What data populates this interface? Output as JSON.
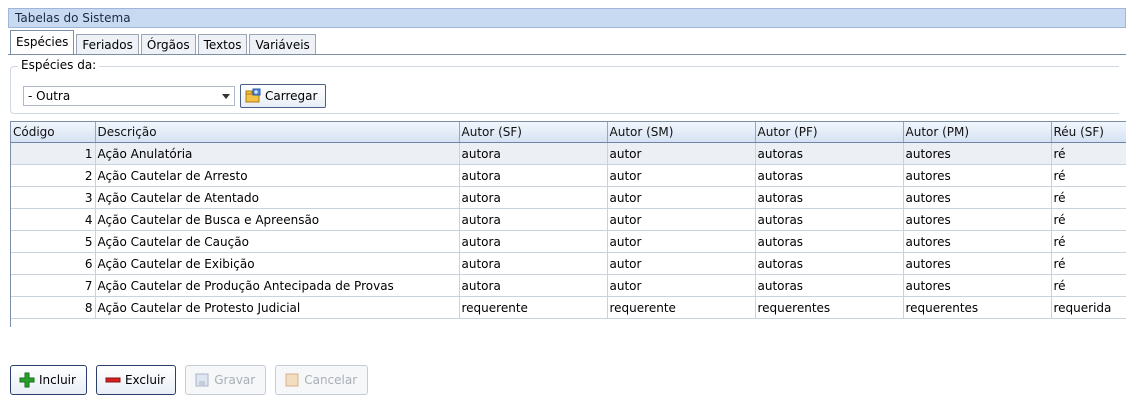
{
  "window": {
    "title": "Tabelas do Sistema"
  },
  "tabs": [
    {
      "label": "Espécies",
      "active": true
    },
    {
      "label": "Feriados"
    },
    {
      "label": "Órgãos"
    },
    {
      "label": "Textos"
    },
    {
      "label": "Variáveis"
    }
  ],
  "filter": {
    "legend": "Espécies da:",
    "select_value": "- Outra",
    "load_label": "Carregar",
    "load_icon": "load-folder-icon"
  },
  "table": {
    "columns": [
      "Código",
      "Descrição",
      "Autor (SF)",
      "Autor (SM)",
      "Autor (PF)",
      "Autor (PM)",
      "Réu (SF)"
    ],
    "rows": [
      [
        "1",
        "Ação Anulatória",
        "autora",
        "autor",
        "autoras",
        "autores",
        "ré"
      ],
      [
        "2",
        "Ação Cautelar de Arresto",
        "autora",
        "autor",
        "autoras",
        "autores",
        "ré"
      ],
      [
        "3",
        "Ação Cautelar de Atentado",
        "autora",
        "autor",
        "autoras",
        "autores",
        "ré"
      ],
      [
        "4",
        "Ação Cautelar de Busca e Apreensão",
        "autora",
        "autor",
        "autoras",
        "autores",
        "ré"
      ],
      [
        "5",
        "Ação Cautelar de Caução",
        "autora",
        "autor",
        "autoras",
        "autores",
        "ré"
      ],
      [
        "6",
        "Ação Cautelar de Exibição",
        "autora",
        "autor",
        "autoras",
        "autores",
        "ré"
      ],
      [
        "7",
        "Ação Cautelar de Produção Antecipada de Provas",
        "autora",
        "autor",
        "autoras",
        "autores",
        "ré"
      ],
      [
        "8",
        "Ação Cautelar de Protesto Judicial",
        "requerente",
        "requerente",
        "requerentes",
        "requerentes",
        "requerida"
      ]
    ]
  },
  "actions": {
    "include": "Incluir",
    "delete": "Excluir",
    "save": "Gravar",
    "cancel": "Cancelar"
  },
  "colors": {
    "include_icon": "#2aa02a",
    "delete_icon": "#d42020",
    "header_bg": "#c8daf2"
  }
}
